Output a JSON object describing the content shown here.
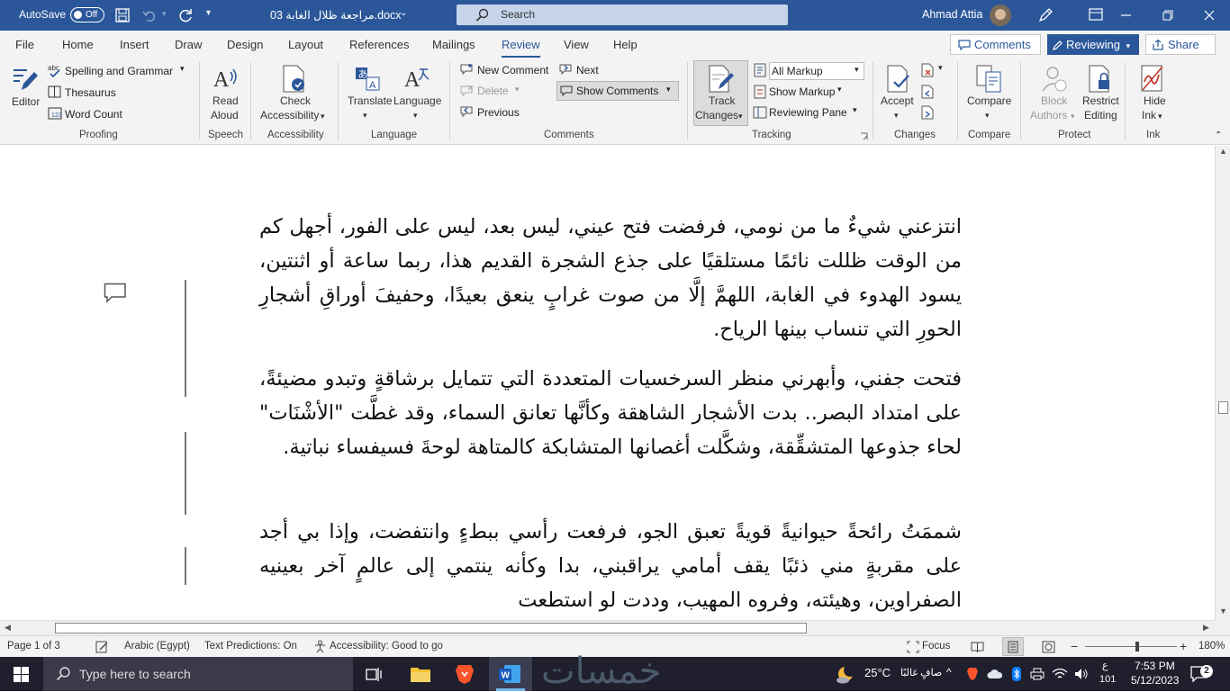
{
  "titlebar": {
    "autosave_label": "AutoSave",
    "autosave_state": "Off",
    "doc_title": "مراجعة ظلال الغابة 03.docx",
    "search_placeholder": "Search",
    "user_name": "Ahmad Attia"
  },
  "tabs": {
    "items": [
      "File",
      "Home",
      "Insert",
      "Draw",
      "Design",
      "Layout",
      "References",
      "Mailings",
      "Review",
      "View",
      "Help"
    ],
    "active": "Review",
    "comments_btn": "Comments",
    "reviewing_btn": "Reviewing",
    "share_btn": "Share"
  },
  "ribbon": {
    "editor": "Editor",
    "spelling": "Spelling and Grammar",
    "thesaurus": "Thesaurus",
    "word_count": "Word Count",
    "proofing": "Proofing",
    "read_aloud_1": "Read",
    "read_aloud_2": "Aloud",
    "speech": "Speech",
    "check_acc_1": "Check",
    "check_acc_2": "Accessibility",
    "accessibility": "Accessibility",
    "translate": "Translate",
    "language_btn": "Language",
    "language": "Language",
    "new_comment": "New Comment",
    "delete": "Delete",
    "previous": "Previous",
    "next": "Next",
    "show_comments": "Show Comments",
    "comments": "Comments",
    "track_1": "Track",
    "track_2": "Changes",
    "all_markup": "All Markup",
    "show_markup": "Show Markup",
    "reviewing_pane": "Reviewing Pane",
    "tracking": "Tracking",
    "accept": "Accept",
    "changes": "Changes",
    "compare_btn": "Compare",
    "compare": "Compare",
    "block_1": "Block",
    "block_2": "Authors",
    "restrict_1": "Restrict",
    "restrict_2": "Editing",
    "protect": "Protect",
    "hide_1": "Hide",
    "hide_2": "Ink",
    "ink": "Ink"
  },
  "document": {
    "p1": "انتزعني شيءٌ ما من نومي، فرفضت فتح عيني، ليس بعد، ليس على الفور، أجهل كم من الوقت ظللت نائمًا مستلقيًا على جذع الشجرة القديم هذا، ربما ساعة أو اثنتين، يسود الهدوء في الغابة، اللهمَّ إلَّا من صوت غرابٍ ينعق بعيدًا، وحفيفَ أوراقِ أشجارِ الحورِ التي تنساب بينها الرياح.",
    "p2": "فتحت جفني، وأبهرني منظر السرخسيات المتعددة التي تتمايل برشاقةٍ وتبدو مضيئةً، على امتداد البصر.. بدت الأشجار الشاهقة وكأنَّها تعانق السماء، وقد غطَّت \"الأشْنَات\" لحاء جذوعها المتشقِّقة، وشكَّلت أغصانها المتشابكة كالمتاهة لوحةَ فسيفساء نباتية.",
    "p3": "شممَتُ رائحةً حيوانيةً قويةً تعبق الجو، فرفعت رأسي ببطءٍ وانتفضت، وإذا بي أجد على مقربةٍ مني ذئبًا يقف أمامي يراقبني، بدا وكأنه ينتمي إلى عالمٍ آخر بعينيه الصفراوين، وهيئته، وفروه المهيب، وددت لو استطعت"
  },
  "statusbar": {
    "page": "Page 1 of 3",
    "language": "Arabic (Egypt)",
    "predictions": "Text Predictions: On",
    "accessibility": "Accessibility: Good to go",
    "focus": "Focus",
    "zoom": "180%"
  },
  "taskbar": {
    "search_placeholder": "Type here to search",
    "watermark": "خمسات",
    "temperature": "25°C",
    "weather": "صافٍ غالبًا",
    "lang": "ع",
    "lang_code": "101",
    "time": "7:53 PM",
    "date": "5/12/2023",
    "notifications": "2"
  },
  "colors": {
    "brand": "#2b579a",
    "taskbar": "#1f1f2e"
  }
}
